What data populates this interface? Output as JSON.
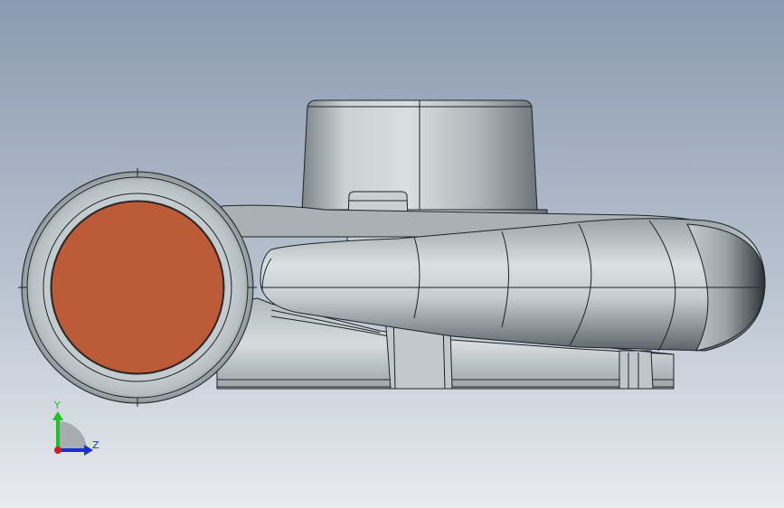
{
  "viewport": {
    "background_top": "#8c9bb1",
    "background_bottom": "#e6e9ee",
    "part_color": "#c7ced2",
    "part_shadow": "#5a6168",
    "edge_color": "#1d2226",
    "face_highlight_color": "#bb5b37"
  },
  "triad": {
    "y_label": "Y",
    "z_label": "Z",
    "y_color": "#22c022",
    "z_color": "#1c2fd6",
    "x_color": "#d41d1d"
  }
}
